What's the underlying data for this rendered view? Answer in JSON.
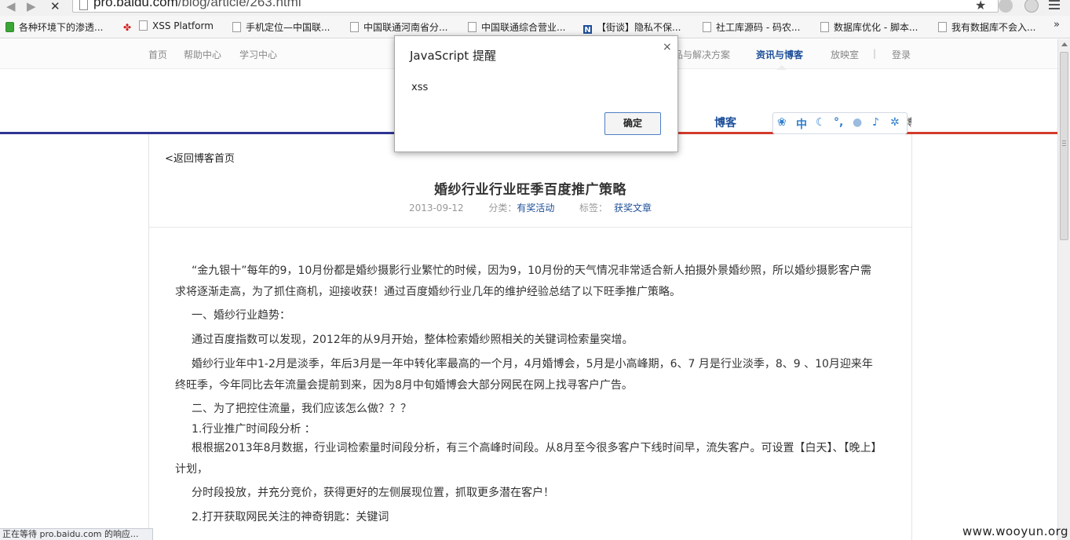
{
  "browser": {
    "url_host": "pro.baidu.com",
    "url_path": "/blog/article/263.html",
    "bookmarks": [
      {
        "label": "各种环境下的渗透...",
        "icon": "evernote-icon"
      },
      {
        "label": "XSS Platform",
        "icon": "page-icon"
      },
      {
        "label": "手机定位—中国联...",
        "icon": "page-icon"
      },
      {
        "label": "中国联通河南省分...",
        "icon": "page-icon"
      },
      {
        "label": "中国联通综合营业...",
        "icon": "page-icon"
      },
      {
        "label": "【街谈】隐私不保...",
        "icon": "n-icon"
      },
      {
        "label": "社工库源码 - 码农...",
        "icon": "page-icon"
      },
      {
        "label": "数据库优化 - 脚本...",
        "icon": "page-icon"
      },
      {
        "label": "我有数据库不会入...",
        "icon": "page-icon"
      }
    ],
    "bookmarks_more": "»",
    "status_text": "正在等待 pro.baidu.com 的响应..."
  },
  "site_nav": {
    "items": [
      "首页",
      "帮助中心",
      "学习中心"
    ],
    "right_items": [
      "品与解决方案",
      "资讯与博客",
      "放映室"
    ],
    "separator": "|",
    "login": "登录",
    "channel_blog": "博客",
    "channel_cut": "博"
  },
  "ime_toolbar": {
    "icons": [
      "paw-icon",
      "chinese-mode-icon",
      "moon-icon",
      "punctuation-icon",
      "user-icon",
      "microphone-icon",
      "gear-icon"
    ],
    "chinese_mode": "中"
  },
  "alert": {
    "title": "JavaScript 提醒",
    "message": "xss",
    "ok_label": "确定",
    "close": "×"
  },
  "article": {
    "back_link": "返回博客首页",
    "title": "婚纱行业行业旺季百度推广策略",
    "date": "2013-09-12",
    "category_label": "分类：",
    "category": "有奖活动",
    "tag_label": "标签：",
    "tag": "获奖文章",
    "paragraphs": [
      "“金九银十”每年的9，10月份都是婚纱摄影行业繁忙的时候，因为9，10月份的天气情况非常适合新人拍摄外景婚纱照，所以婚纱摄影客户需求将逐渐走高，为了抓住商机，迎接收获！通过百度婚纱行业几年的维护经验总结了以下旺季推广策略。",
      "一、婚纱行业趋势：",
      "通过百度指数可以发现，2012年的从9月开始，整体检索婚纱照相关的关键词检索量突增。",
      "婚纱行业年中1-2月是淡季，年后3月是一年中转化率最高的一个月，4月婚博会，5月是小高峰期，6、7 月是行业淡季，8、9 、10月迎来年终旺季，今年同比去年流量会提前到来，因为8月中旬婚博会大部分网民在网上找寻客户广告。",
      "二、为了把控住流量，我们应该怎么做？？？",
      "1.行业推广时间段分析 ：",
      "根根据2013年8月数据，行业词检索量时间段分析，有三个高峰时间段。从8月至今很多客户下线时间早，流失客户。可设置【白天】、【晚上】计划，",
      "分时段投放，并充分竞价，获得更好的左侧展现位置，抓取更多潜在客户！",
      "2.打开获取网民关注的神奇钥匙：关键词"
    ]
  },
  "watermark": "www.wooyun.org"
}
